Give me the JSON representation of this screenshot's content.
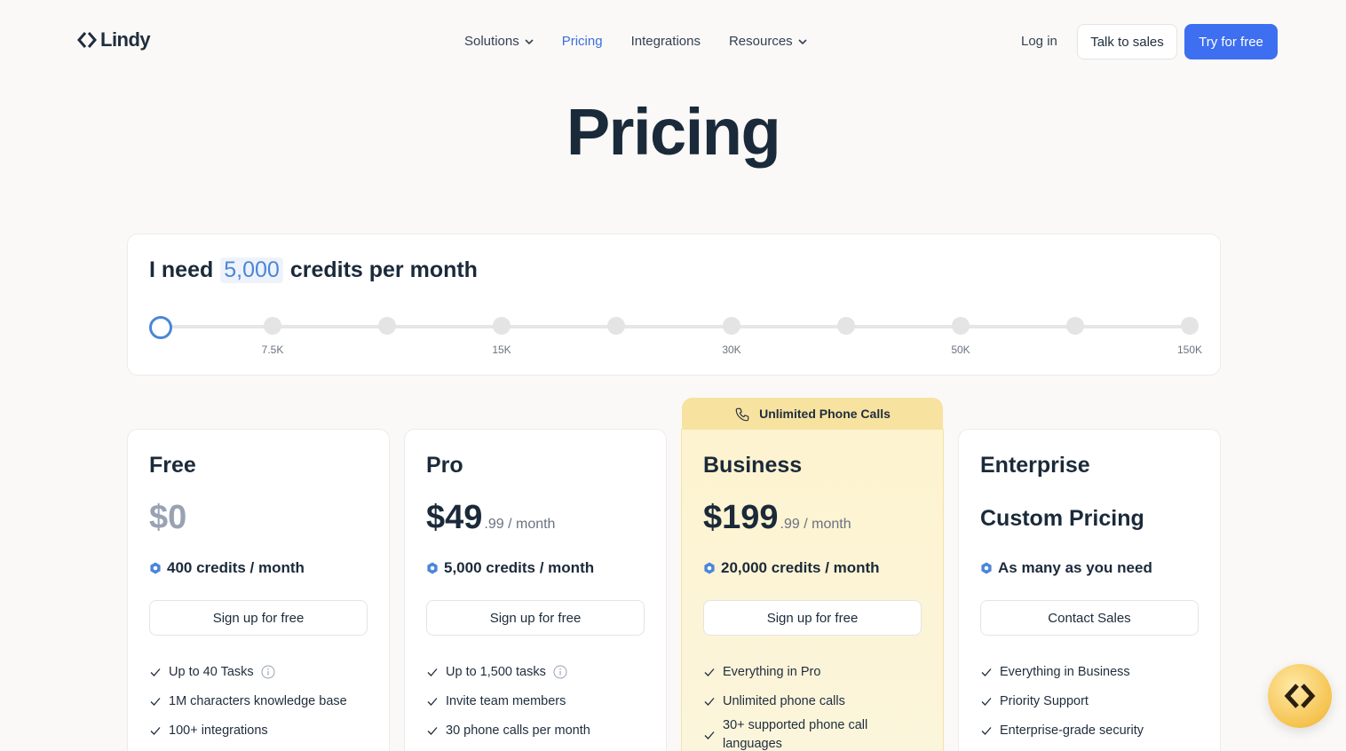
{
  "nav": {
    "logo": "Lindy",
    "menu": [
      {
        "label": "Solutions",
        "has_dropdown": true
      },
      {
        "label": "Pricing",
        "active": true
      },
      {
        "label": "Integrations"
      },
      {
        "label": "Resources",
        "has_dropdown": true
      }
    ],
    "login": "Log in",
    "talk_to_sales": "Talk to sales",
    "try_free": "Try for free"
  },
  "title": "Pricing",
  "credits": {
    "prefix": "I need",
    "value": "5,000",
    "suffix": "credits per month",
    "ticks": [
      "7.5K",
      "15K",
      "30K",
      "50K",
      "150K"
    ]
  },
  "ribbon": "Unlimited Phone Calls",
  "plans": [
    {
      "name": "Free",
      "price": "$0",
      "credits": "400 credits / month",
      "cta": "Sign up for free",
      "features": [
        "Up to 40 Tasks",
        "1M characters knowledge base",
        "100+ integrations"
      ]
    },
    {
      "name": "Pro",
      "price": "$49",
      "price_cents": ".99 / month",
      "credits": "5,000 credits / month",
      "cta": "Sign up for free",
      "features": [
        "Up to 1,500 tasks",
        "Invite team members",
        "30 phone calls per month"
      ]
    },
    {
      "name": "Business",
      "price": "$199",
      "price_cents": ".99 / month",
      "credits": "20,000 credits / month",
      "cta": "Sign up for free",
      "features": [
        "Everything in Pro",
        "Unlimited phone calls",
        "30+ supported phone call languages"
      ]
    },
    {
      "name": "Enterprise",
      "price_label": "Custom Pricing",
      "credits": "As many as you need",
      "cta": "Contact Sales",
      "features": [
        "Everything in Business",
        "Priority Support",
        "Enterprise-grade security"
      ]
    }
  ],
  "colors": {
    "accent": "#3d6ff0",
    "highlight": "#4a86d8",
    "ribbon": "#f7e2a0"
  }
}
